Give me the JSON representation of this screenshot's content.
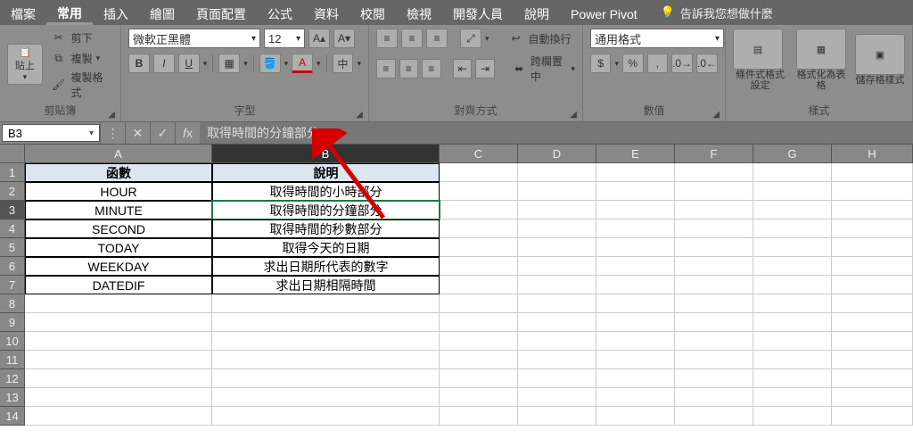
{
  "tabs": {
    "file": "檔案",
    "home": "常用",
    "insert": "插入",
    "draw": "繪圖",
    "layout": "頁面配置",
    "formulas": "公式",
    "data": "資料",
    "review": "校閱",
    "view": "檢視",
    "developer": "開發人員",
    "help": "說明",
    "powerpivot": "Power Pivot",
    "tellme": "告訴我您想做什麼"
  },
  "groups": {
    "clipboard": "剪貼簿",
    "font": "字型",
    "alignment": "對齊方式",
    "number": "數值",
    "styles": "樣式"
  },
  "clipboard": {
    "paste": "貼上",
    "cut": "剪下",
    "copy": "複製",
    "painter": "複製格式"
  },
  "font": {
    "name": "微軟正黑體",
    "size": "12",
    "bold": "B",
    "italic": "I",
    "underline": "U"
  },
  "alignment": {
    "wrap": "自動換行",
    "merge": "跨欄置中"
  },
  "number": {
    "format": "通用格式"
  },
  "styles": {
    "cond": "條件式格式設定",
    "table": "格式化為表格",
    "cell": "儲存格樣式"
  },
  "namebox": "B3",
  "formula": "取得時間的分鐘部分",
  "columns": [
    "A",
    "B",
    "C",
    "D",
    "E",
    "F",
    "G",
    "H"
  ],
  "rows": [
    "1",
    "2",
    "3",
    "4",
    "5",
    "6",
    "7",
    "8",
    "9",
    "10",
    "11",
    "12",
    "13",
    "14"
  ],
  "tableHeader": {
    "A": "函數",
    "B": "說明"
  },
  "tableData": [
    {
      "A": "HOUR",
      "B": "取得時間的小時部分"
    },
    {
      "A": "MINUTE",
      "B": "取得時間的分鐘部分"
    },
    {
      "A": "SECOND",
      "B": "取得時間的秒數部分"
    },
    {
      "A": "TODAY",
      "B": "取得今天的日期"
    },
    {
      "A": "WEEKDAY",
      "B": "求出日期所代表的數字"
    },
    {
      "A": "DATEDIF",
      "B": "求出日期相隔時間"
    }
  ],
  "chart_data": {
    "type": "table",
    "columns": [
      "函數",
      "說明"
    ],
    "rows": [
      [
        "HOUR",
        "取得時間的小時部分"
      ],
      [
        "MINUTE",
        "取得時間的分鐘部分"
      ],
      [
        "SECOND",
        "取得時間的秒數部分"
      ],
      [
        "TODAY",
        "取得今天的日期"
      ],
      [
        "WEEKDAY",
        "求出日期所代表的數字"
      ],
      [
        "DATEDIF",
        "求出日期相隔時間"
      ]
    ]
  }
}
